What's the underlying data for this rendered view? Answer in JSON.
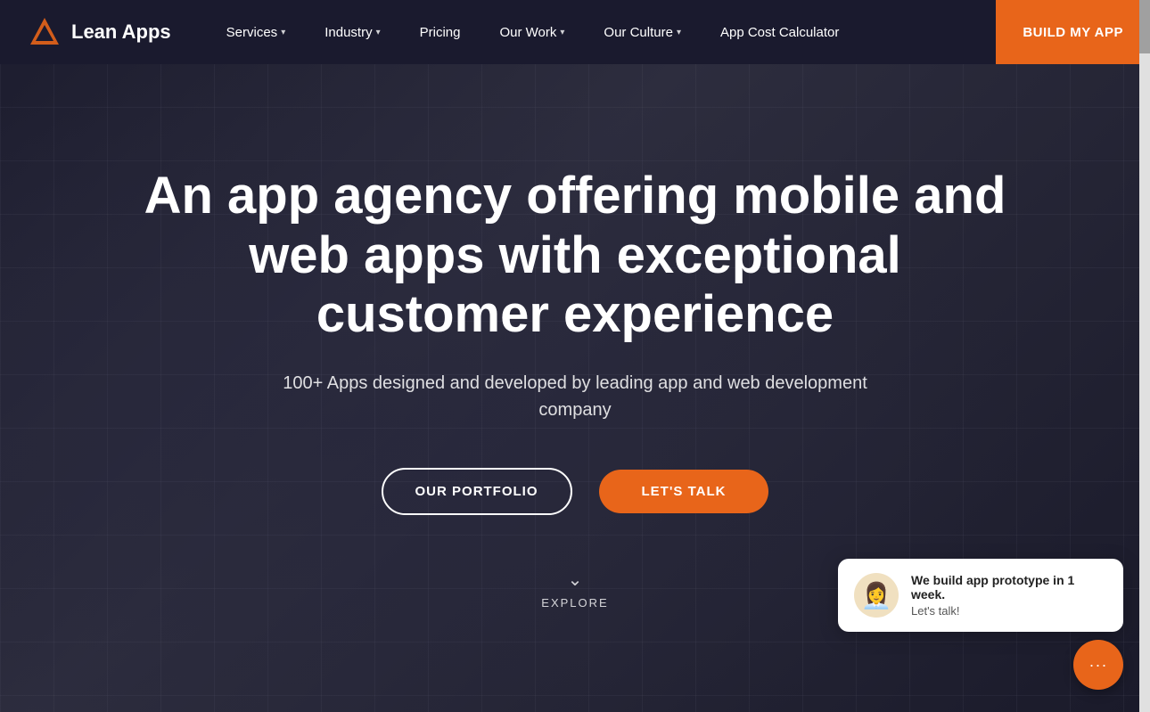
{
  "brand": {
    "logo_text": "Lean Apps",
    "logo_icon": "triangle"
  },
  "nav": {
    "items": [
      {
        "label": "Services",
        "has_dropdown": true
      },
      {
        "label": "Industry",
        "has_dropdown": true
      },
      {
        "label": "Pricing",
        "has_dropdown": false
      },
      {
        "label": "Our Work",
        "has_dropdown": true
      },
      {
        "label": "Our Culture",
        "has_dropdown": true
      },
      {
        "label": "App Cost Calculator",
        "has_dropdown": false
      }
    ],
    "cta_label": "BUILD MY APP"
  },
  "hero": {
    "title": "An app agency offering mobile and web apps with exceptional customer experience",
    "subtitle": "100+ Apps designed and developed by leading app and web development company",
    "btn_portfolio": "OUR PORTFOLIO",
    "btn_talk": "LET'S TALK",
    "explore_label": "EXPLORE"
  },
  "chat": {
    "headline": "We build app prototype in 1 week.",
    "subtext": "Let's talk!",
    "avatar_emoji": "👩‍💼"
  }
}
